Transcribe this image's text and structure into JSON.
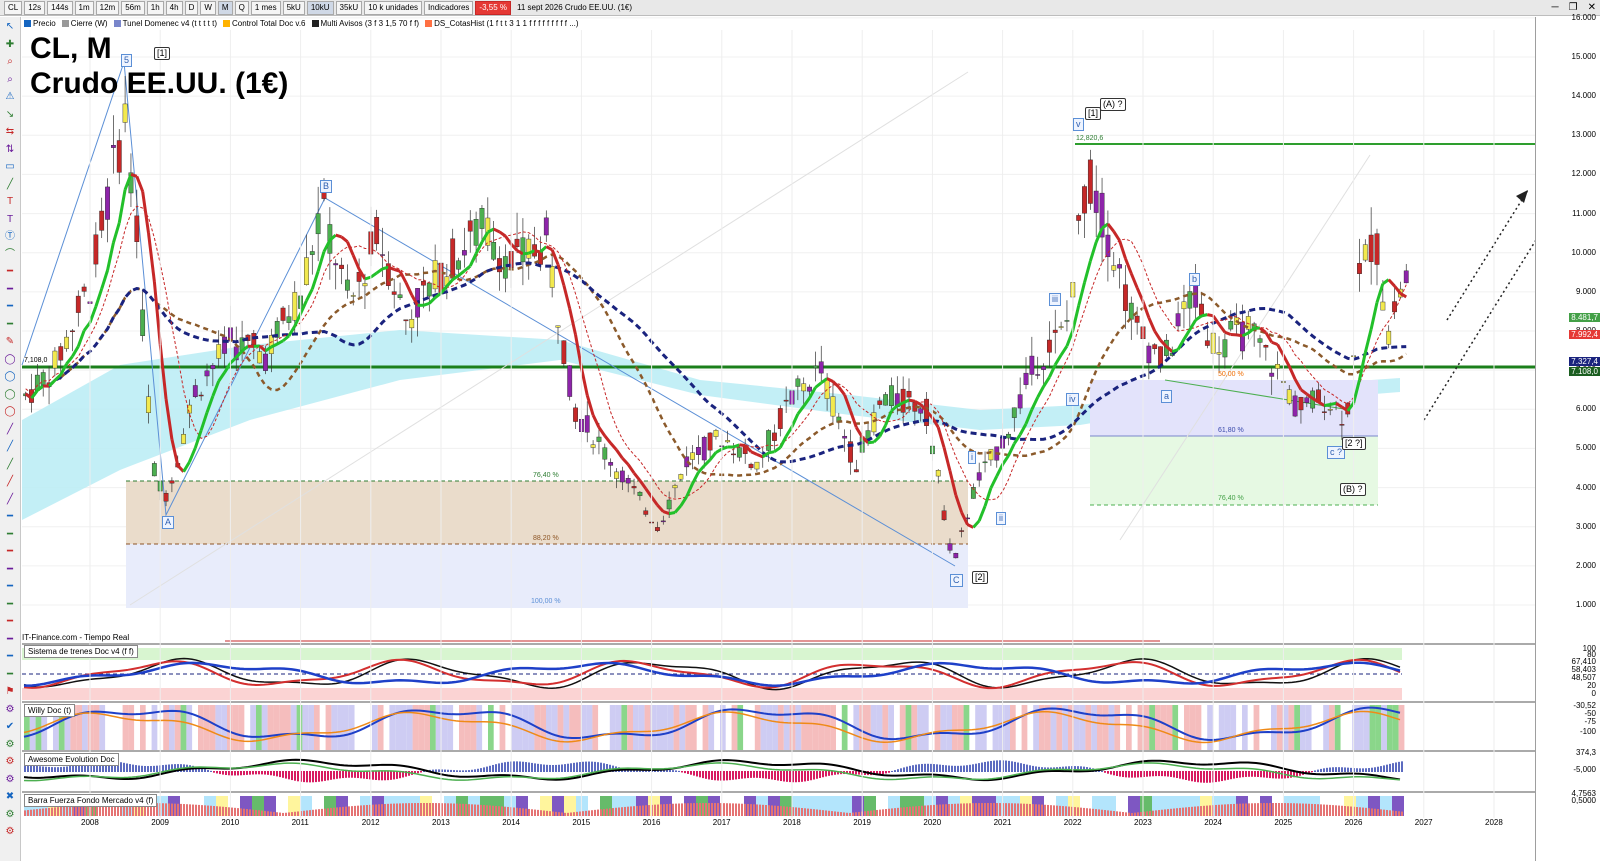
{
  "toolbar": {
    "symbol": "CL",
    "intervals": [
      "12s",
      "144s",
      "1m",
      "12m",
      "56m",
      "1h",
      "4h",
      "D",
      "W",
      "M",
      "Q"
    ],
    "active_interval": "M",
    "period": "1 mes",
    "units": [
      "5kU",
      "10kU",
      "35kU"
    ],
    "units_select": "10 k unidades",
    "indicators": "Indicadores",
    "change_badge": "-3,55 %",
    "window_title": "11 sept 2026  Crudo EE.UU. (1€)"
  },
  "legend": {
    "items": [
      "Precio",
      "Cierre (W)",
      "Tunel Domenec v4 (t t t t t)",
      "Control Total Doc v.6",
      "Multi Avisos (3 f 3 1,5 70 f f)",
      "DS_CotasHist (1 f t t 3 1 1 f f f f f f f f f ...)"
    ],
    "colors": [
      "#1565c0",
      "#999999",
      "#7986cb",
      "#ffb300",
      "#212121",
      "#ff7043"
    ]
  },
  "chart": {
    "title_line1": "CL, M",
    "title_line2": "Crudo EE.UU. (1€)",
    "source": "IT-Finance.com - Tiempo Real",
    "support_label": "7,108,0",
    "high_label": "12,820,6",
    "fib_labels": [
      "76,40 %",
      "88,20 %",
      "100,00 %",
      "50,00 %",
      "61,80 %",
      "76,40 %"
    ],
    "wave_labels": [
      "5",
      "[1]",
      "A",
      "B",
      "C",
      "[2]",
      "i",
      "ii",
      "iii",
      "iv",
      "v",
      "[1]",
      "(A) ?",
      "a",
      "b",
      "c ?",
      "[2 ?]",
      "(B) ?"
    ],
    "price_ticks": [
      "16.000",
      "15.000",
      "14.000",
      "13.000",
      "12.000",
      "11.000",
      "10.000",
      "9.000",
      "8.000",
      "7.000",
      "6.000",
      "5.000",
      "4.000",
      "3.000",
      "2.000",
      "1.000"
    ],
    "price_tags": [
      "8.481,7",
      "7.992,4",
      "7.327,4",
      "7.108,0"
    ],
    "price_tag_colors": [
      "#43a047",
      "#e53935",
      "#1a237e",
      "#1b5e20"
    ],
    "years": [
      "2008",
      "2009",
      "2010",
      "2011",
      "2012",
      "2013",
      "2014",
      "2015",
      "2016",
      "2017",
      "2018",
      "2019",
      "2020",
      "2021",
      "2022",
      "2023",
      "2024",
      "2025",
      "2026",
      "2027",
      "2028"
    ]
  },
  "panels": [
    {
      "title": "Sistema de trenes Doc v4 (f f)",
      "ticks": [
        "100",
        "80",
        "67,410",
        "58,403",
        "48,507",
        "20",
        "0"
      ]
    },
    {
      "title": "Willy Doc (t)",
      "ticks": [
        "-30,52",
        "-50",
        "-75",
        "-100"
      ]
    },
    {
      "title": "Awesome Evolution Doc",
      "ticks": [
        "374,3",
        "-5,000"
      ]
    },
    {
      "title": "Barra Fuerza Fondo Mercado v4 (f)",
      "ticks": [
        "4,7563",
        "0,5000"
      ]
    }
  ]
}
